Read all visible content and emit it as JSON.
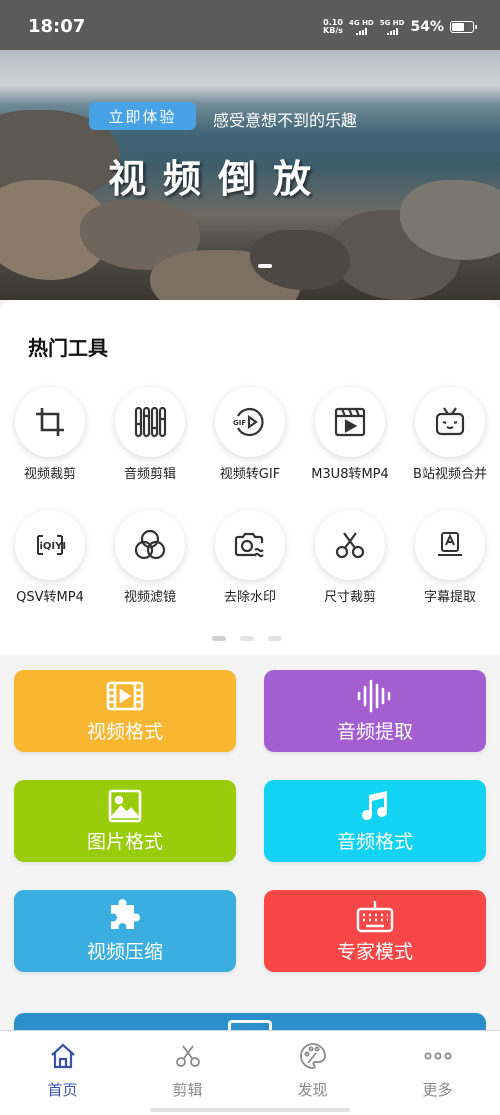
{
  "status_bar": {
    "time": "18:07",
    "speed_value": "0.10",
    "speed_unit": "KB/s",
    "net1": "4G HD",
    "net2": "5G HD",
    "battery": "54%"
  },
  "banner": {
    "button_label": "立即体验",
    "subtitle": "感受意想不到的乐趣",
    "title": "视频倒放"
  },
  "tools": {
    "heading": "热门工具",
    "items": [
      {
        "label": "视频裁剪",
        "icon": "crop-icon"
      },
      {
        "label": "音频剪辑",
        "icon": "equalizer-icon"
      },
      {
        "label": "视频转GIF",
        "icon": "gif-icon"
      },
      {
        "label": "M3U8转MP4",
        "icon": "video-clapper-icon"
      },
      {
        "label": "B站视频合并",
        "icon": "bilibili-tv-icon"
      },
      {
        "label": "QSV转MP4",
        "icon": "iqiyi-icon"
      },
      {
        "label": "视频滤镜",
        "icon": "filter-circles-icon"
      },
      {
        "label": "去除水印",
        "icon": "camera-wave-icon"
      },
      {
        "label": "尺寸裁剪",
        "icon": "scissors-icon"
      },
      {
        "label": "字幕提取",
        "icon": "subtitle-icon"
      }
    ]
  },
  "features": [
    {
      "label": "视频格式",
      "icon": "film-icon",
      "color": "#f9b731"
    },
    {
      "label": "音频提取",
      "icon": "audio-wave-icon",
      "color": "#a35fd0"
    },
    {
      "label": "图片格式",
      "icon": "image-icon",
      "color": "#99cc0a"
    },
    {
      "label": "音频格式",
      "icon": "music-note-icon",
      "color": "#12d3f2"
    },
    {
      "label": "视频压缩",
      "icon": "puzzle-icon",
      "color": "#3aaee0"
    },
    {
      "label": "专家模式",
      "icon": "keyboard-icon",
      "color": "#f94646"
    }
  ],
  "bottom_nav": [
    {
      "label": "首页",
      "icon": "home-icon",
      "active": true
    },
    {
      "label": "剪辑",
      "icon": "scissors-icon",
      "active": false
    },
    {
      "label": "发现",
      "icon": "palette-icon",
      "active": false
    },
    {
      "label": "更多",
      "icon": "more-dots-icon",
      "active": false
    }
  ],
  "colors": {
    "accent": "#3a53a8",
    "banner_button": "#47a3e6"
  }
}
